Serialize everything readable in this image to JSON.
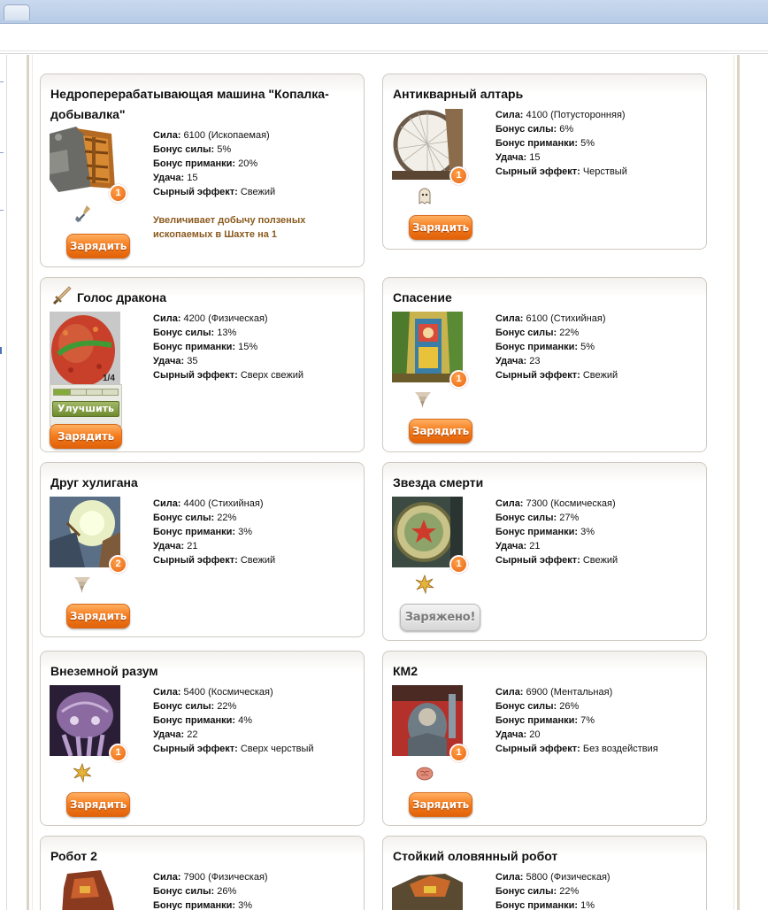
{
  "labels": {
    "power": "Сила:",
    "power_bonus": "Бонус силы:",
    "attraction_bonus": "Бонус приманки:",
    "luck": "Удача:",
    "cheese_effect": "Сырный эффект:",
    "arm_button": "Зарядить",
    "armed_button": "Заряжено!",
    "upgrade_button": "Улучшить"
  },
  "colors": {
    "button_orange": "#f47a1b",
    "badge_orange": "#e96510",
    "note_brown": "#8a5a1e"
  },
  "traps": [
    {
      "name": "Недропере­рабатывающая машина \"Копалка-добывалка\"",
      "power": "6100",
      "power_type": "(Ископаемая)",
      "power_bonus": "5%",
      "attraction_bonus": "20%",
      "luck": "15",
      "cheese_effect": "Свежий",
      "badge": "1",
      "power_icon": "shovel-icon",
      "note": "Увеличивает добычу ползеных ископаемых в Шахте на 1",
      "button": "arm"
    },
    {
      "name": "Антикварный алтарь",
      "power": "4100",
      "power_type": "(Потусторонняя)",
      "power_bonus": "6%",
      "attraction_bonus": "5%",
      "luck": "15",
      "cheese_effect": "Черствый",
      "badge": "1",
      "power_icon": "ghost-icon",
      "button": "arm"
    },
    {
      "name": "Голос дракона",
      "power": "4200",
      "power_type": "(Физическая)",
      "power_bonus": "13%",
      "attraction_bonus": "15%",
      "luck": "35",
      "cheese_effect": "Сверх свежий",
      "level": "1/4",
      "level_progress": 0.25,
      "title_icon": "sword-icon",
      "button": "arm"
    },
    {
      "name": "Спасение",
      "power": "6100",
      "power_type": "(Стихийная)",
      "power_bonus": "22%",
      "attraction_bonus": "5%",
      "luck": "23",
      "cheese_effect": "Свежий",
      "badge": "1",
      "power_icon": "tornado-icon",
      "button": "arm"
    },
    {
      "name": "Друг хулигана",
      "power": "4400",
      "power_type": "(Стихийная)",
      "power_bonus": "22%",
      "attraction_bonus": "3%",
      "luck": "21",
      "cheese_effect": "Свежий",
      "badge": "2",
      "power_icon": "tornado-icon",
      "button": "arm"
    },
    {
      "name": "Звезда смерти",
      "power": "7300",
      "power_type": "(Космическая)",
      "power_bonus": "27%",
      "attraction_bonus": "3%",
      "luck": "21",
      "cheese_effect": "Свежий",
      "badge": "1",
      "power_icon": "star-burst-icon",
      "button": "armed"
    },
    {
      "name": "Внеземной разум",
      "power": "5400",
      "power_type": "(Космическая)",
      "power_bonus": "22%",
      "attraction_bonus": "4%",
      "luck": "22",
      "cheese_effect": "Сверх черствый",
      "badge": "1",
      "power_icon": "star-burst-icon",
      "button": "arm"
    },
    {
      "name": "КМ2",
      "power": "6900",
      "power_type": "(Ментальная)",
      "power_bonus": "26%",
      "attraction_bonus": "7%",
      "luck": "20",
      "cheese_effect": "Без воздействия",
      "badge": "1",
      "power_icon": "brain-icon",
      "button": "arm"
    },
    {
      "name": "Робот 2",
      "power": "7900",
      "power_type": "(Физическая)",
      "power_bonus": "26%",
      "attraction_bonus": "3%"
    },
    {
      "name": "Стойкий оловянный робот",
      "power": "5800",
      "power_type": "(Физическая)",
      "power_bonus": "22%",
      "attraction_bonus": "1%"
    }
  ]
}
